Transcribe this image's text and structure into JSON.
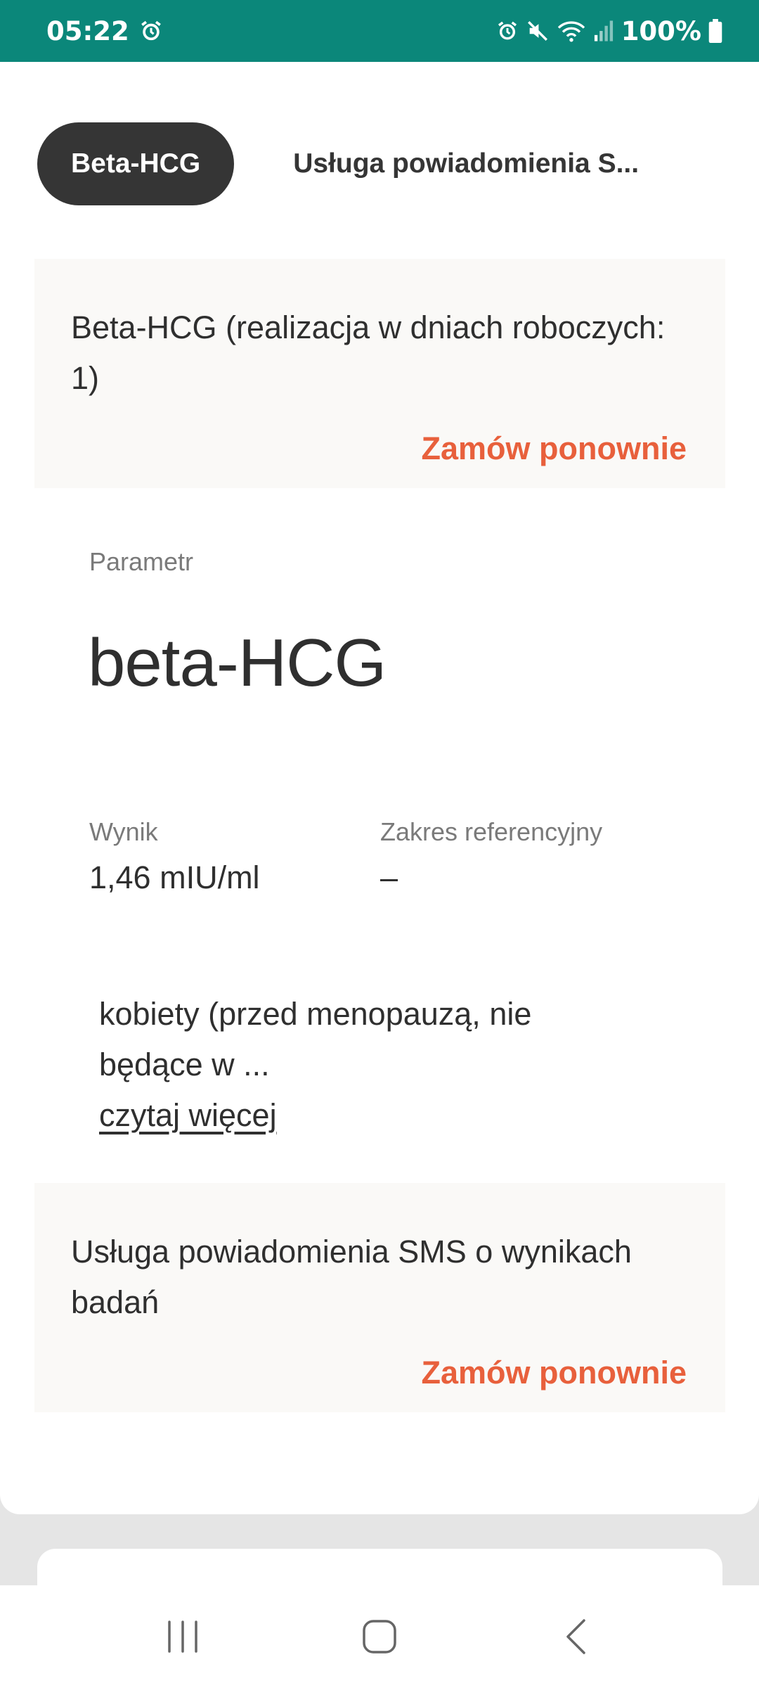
{
  "status_bar": {
    "time": "05:22",
    "battery": "100%",
    "icons": [
      "alarm-icon",
      "alarm-icon",
      "mute-icon",
      "wifi-icon",
      "signal-icon",
      "battery-icon"
    ]
  },
  "tabs": [
    {
      "label": "Beta-HCG",
      "active": true
    },
    {
      "label": "Usługa powiadomienia S...",
      "active": false
    }
  ],
  "orders": [
    {
      "title": "Beta-HCG (realizacja w dniach roboczych: 1)",
      "action": "Zamów ponownie"
    },
    {
      "title": "Usługa powiadomienia SMS o wynikach badań",
      "action": "Zamów ponownie"
    }
  ],
  "parameter": {
    "label": "Parametr",
    "name": "beta-HCG",
    "result_label": "Wynik",
    "result_value": "1,46 mIU/ml",
    "reference_label": "Zakres referencyjny",
    "reference_value": "–",
    "note": "kobiety (przed menopauzą, nie będące w ...",
    "read_more": "czytaj więcej"
  },
  "colors": {
    "status_bar": "#0b877a",
    "accent": "#e8603c",
    "active_tab": "#353535"
  },
  "nav_bar": {
    "icons": [
      "recent-apps-icon",
      "home-icon",
      "back-icon"
    ]
  }
}
